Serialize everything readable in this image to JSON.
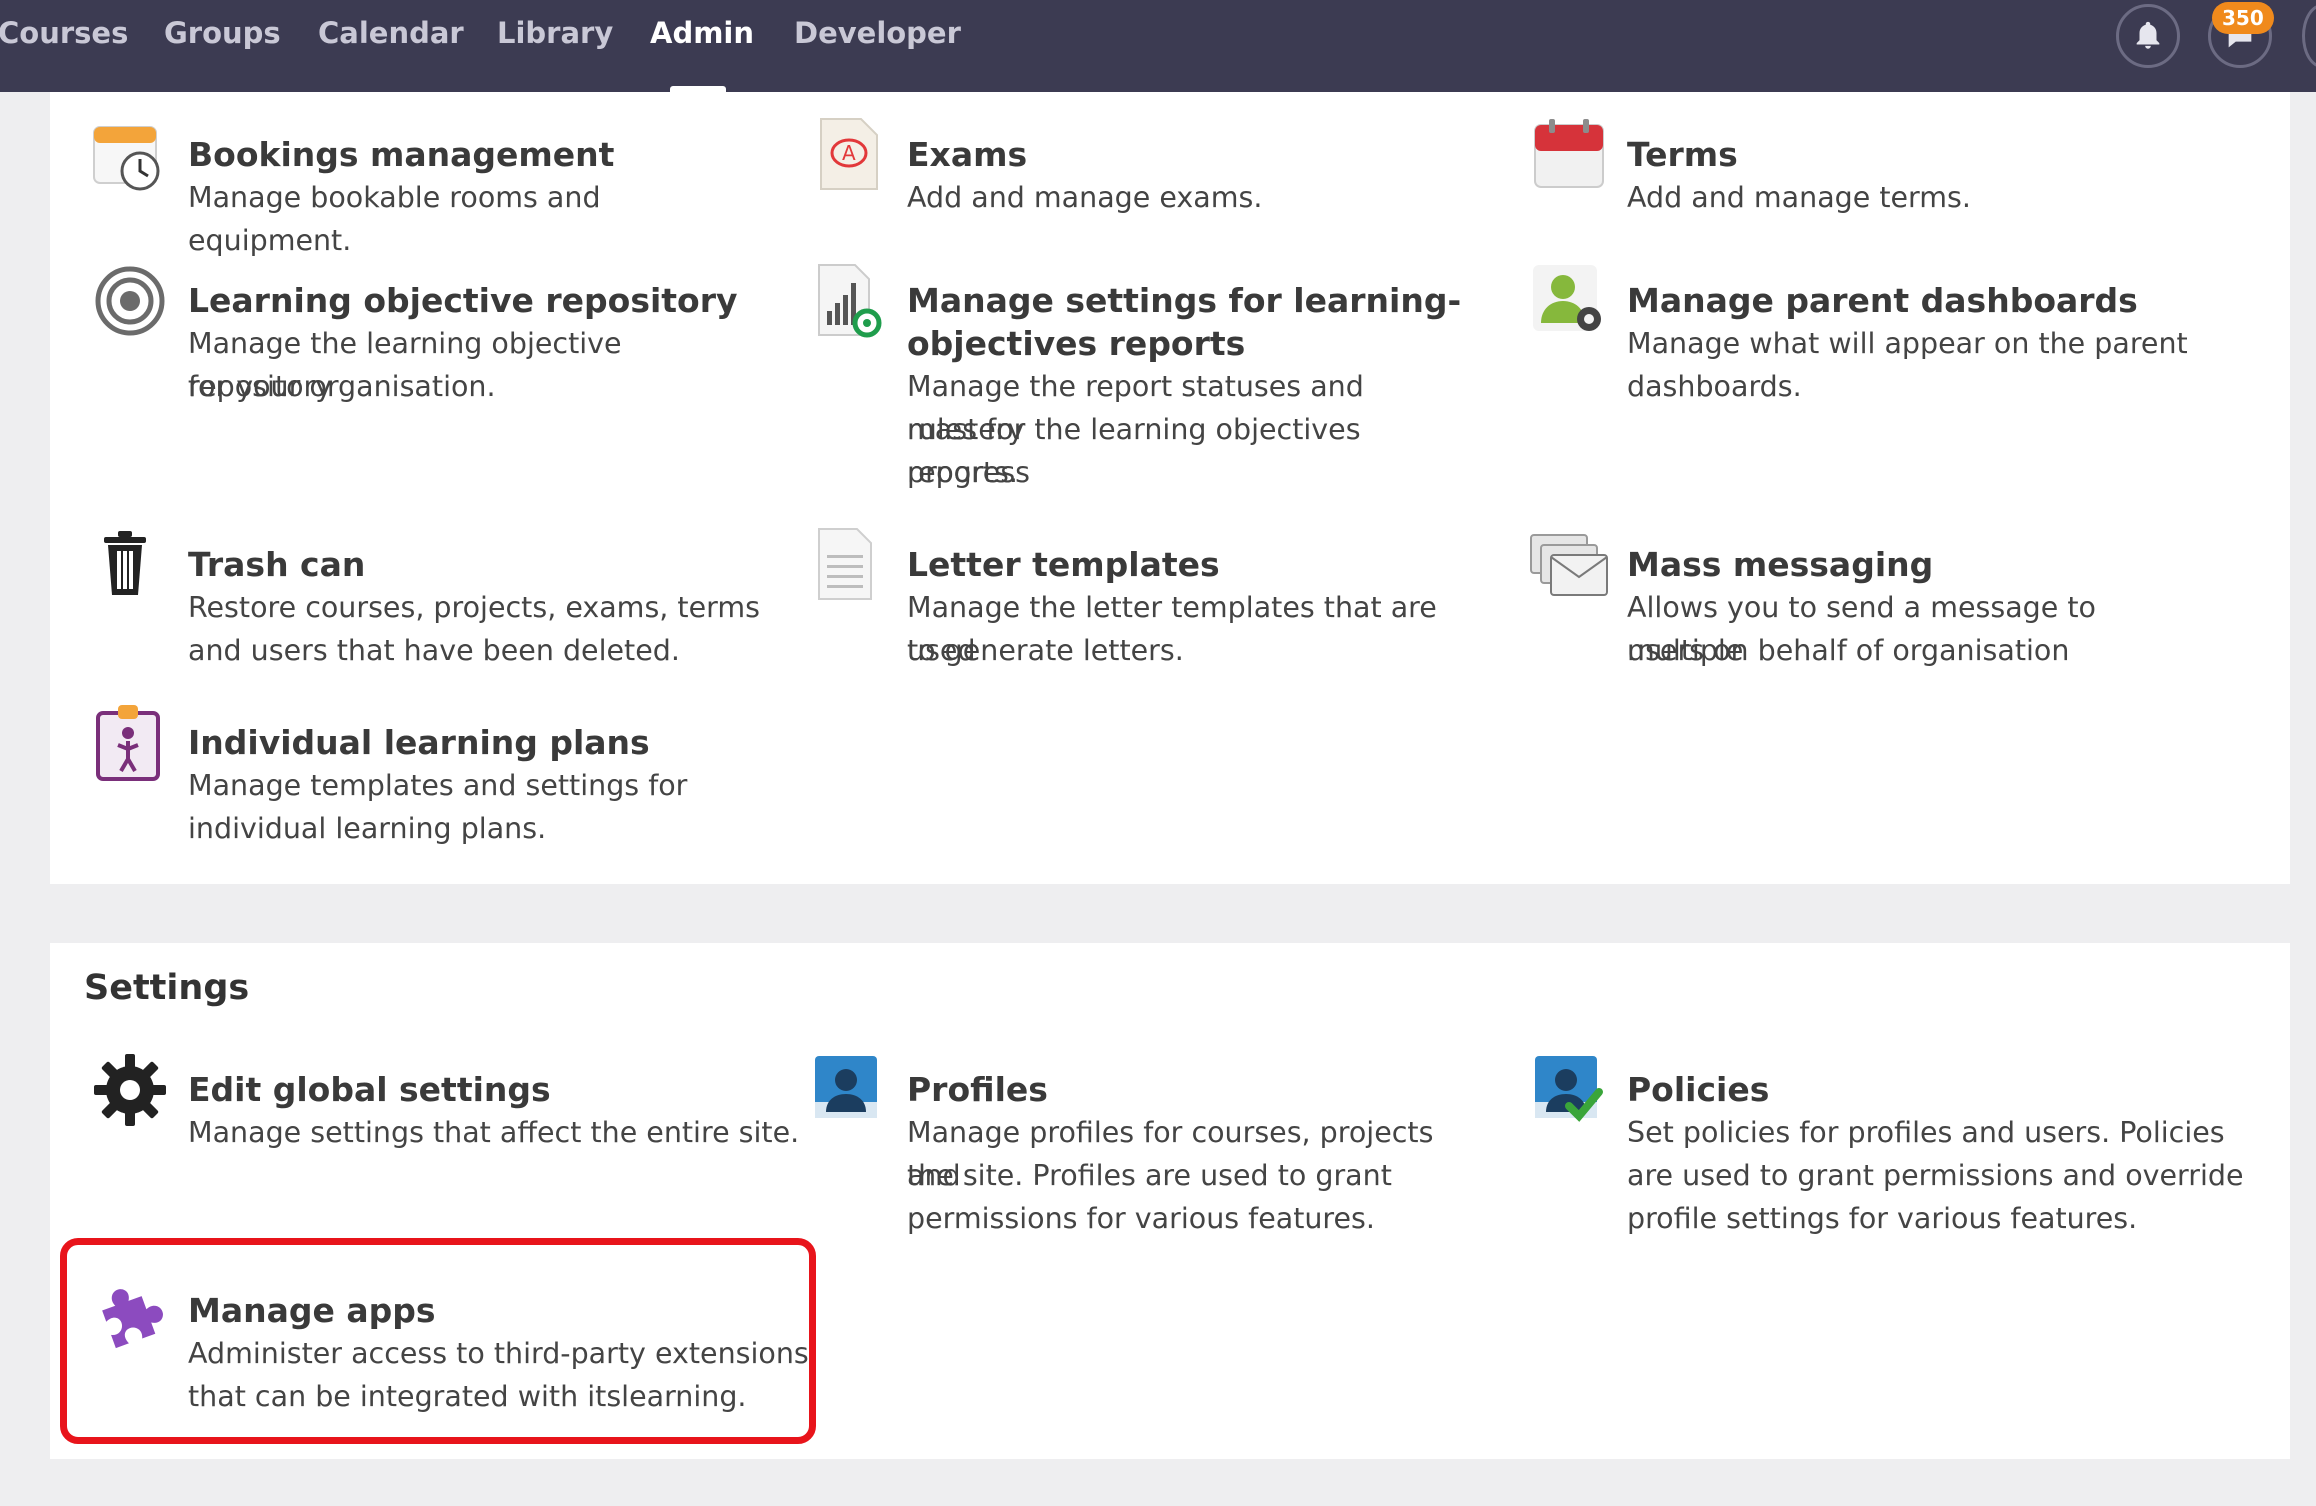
{
  "nav": {
    "items": [
      {
        "label": "Courses",
        "active": false
      },
      {
        "label": "Groups",
        "active": false
      },
      {
        "label": "Calendar",
        "active": false
      },
      {
        "label": "Library",
        "active": false
      },
      {
        "label": "Admin",
        "active": true
      },
      {
        "label": "Developer",
        "active": false
      }
    ],
    "notifications_icon": "bell-icon",
    "messages_icon": "chat-bubble-icon",
    "messages_badge": "350"
  },
  "admin_tools": [
    {
      "title": "Bookings management",
      "desc": [
        "Manage bookable rooms and equipment."
      ],
      "icon": "calendar-clock-icon"
    },
    {
      "title": "Exams",
      "desc": [
        "Add and manage exams."
      ],
      "icon": "exam-paper-icon"
    },
    {
      "title": "Terms",
      "desc": [
        "Add and manage terms."
      ],
      "icon": "red-calendar-icon"
    },
    {
      "title": "Learning objective repository",
      "desc": [
        "Manage the learning objective repository",
        "for your organisation."
      ],
      "icon": "target-icon"
    },
    {
      "title_lines": [
        "Manage settings for learning-",
        "objectives reports"
      ],
      "desc": [
        "Manage the report statuses and mastery",
        "rules for the learning objectives progress",
        "reports."
      ],
      "icon": "report-chart-icon"
    },
    {
      "title": "Manage parent dashboards",
      "desc": [
        "Manage what will appear on the parent",
        "dashboards."
      ],
      "icon": "user-gear-icon"
    },
    {
      "title": "Trash can",
      "desc": [
        "Restore courses, projects, exams, terms",
        "and users that have been deleted."
      ],
      "icon": "trash-can-icon"
    },
    {
      "title": "Letter templates",
      "desc": [
        "Manage the letter templates that are used",
        "to generate letters."
      ],
      "icon": "document-icon"
    },
    {
      "title": "Mass messaging",
      "desc": [
        "Allows you to send a message to multiple",
        "users on behalf of organisation"
      ],
      "icon": "envelopes-icon"
    },
    {
      "title": "Individual learning plans",
      "desc": [
        "Manage templates and settings for",
        "individual learning plans."
      ],
      "icon": "clipboard-person-icon"
    }
  ],
  "settings": {
    "heading": "Settings",
    "tools": [
      {
        "title": "Edit global settings",
        "desc": [
          "Manage settings that affect the entire site."
        ],
        "icon": "gear-icon"
      },
      {
        "title": "Profiles",
        "desc": [
          "Manage profiles for courses, projects and",
          "the site. Profiles are used to grant",
          "permissions for various features."
        ],
        "icon": "profile-icon"
      },
      {
        "title": "Policies",
        "desc": [
          "Set policies for profiles and users. Policies",
          "are used to grant permissions and override",
          "profile settings for various features."
        ],
        "icon": "policy-check-icon"
      },
      {
        "title": "Manage apps",
        "desc": [
          "Administer access to third-party extensions",
          "that can be integrated with itslearning."
        ],
        "icon": "puzzle-piece-icon"
      }
    ]
  },
  "colors": {
    "nav_bg": "#3c3b52",
    "badge": "#f08a1c",
    "highlight": "#e8141b"
  }
}
